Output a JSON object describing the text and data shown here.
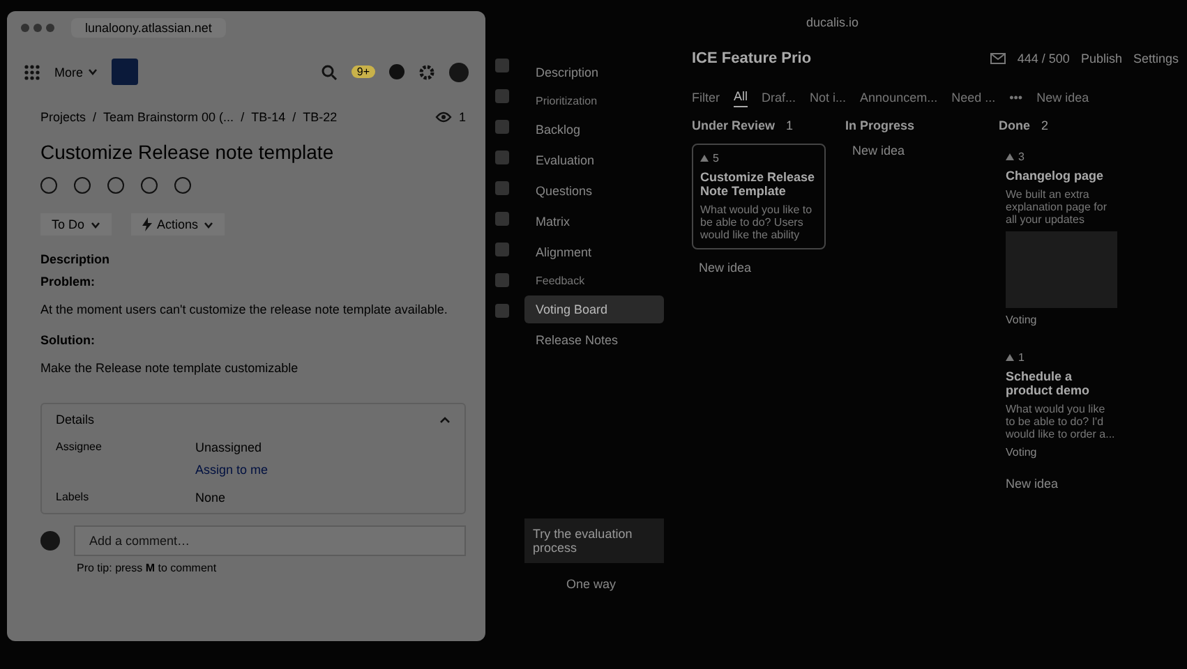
{
  "browser": {
    "url": "lunaloony.atlassian.net"
  },
  "topbar": {
    "more": "More",
    "notification_count": "9+"
  },
  "breadcrumbs": {
    "separator": "/",
    "items": [
      "Projects",
      "Team Brainstorm 00 (...",
      "TB-14",
      "TB-22"
    ]
  },
  "watchers": "1",
  "issue": {
    "title": "Customize Release note template",
    "status": "To Do",
    "actions": "Actions"
  },
  "description": {
    "heading": "Description",
    "problem_label": "Problem:",
    "problem": "At the moment users can't customize the release note template available.",
    "solution_label": "Solution:",
    "solution": "Make the Release note template customizable"
  },
  "details": {
    "heading": "Details",
    "fields": [
      {
        "label": "Assignee",
        "value": "Unassigned",
        "action": "Assign to me"
      },
      {
        "label": "Labels",
        "value": "None"
      }
    ]
  },
  "comment": {
    "placeholder": "Add a comment…",
    "tip_before": "Pro tip: press",
    "tip_key": "M",
    "tip_after": "to comment"
  },
  "right_browser": {
    "url": "ducalis.io"
  },
  "sidebar": {
    "items": [
      {
        "label": "Description",
        "kind": "item",
        "selected": false
      },
      {
        "label": "Prioritization",
        "kind": "section"
      },
      {
        "label": "Backlog",
        "kind": "item",
        "selected": false
      },
      {
        "label": "Evaluation",
        "kind": "item",
        "selected": false
      },
      {
        "label": "Questions",
        "kind": "item",
        "selected": false
      },
      {
        "label": "Matrix",
        "kind": "item",
        "selected": false
      },
      {
        "label": "Alignment",
        "kind": "item",
        "selected": false
      },
      {
        "label": "Feedback",
        "kind": "section"
      },
      {
        "label": "Voting Board",
        "kind": "item",
        "selected": true
      },
      {
        "label": "Release Notes",
        "kind": "item",
        "selected": false
      }
    ],
    "promo": "Try the evaluation process",
    "footer": "One way"
  },
  "board": {
    "title": "ICE Feature Prio",
    "quota": "444 / 500",
    "publish": "Publish",
    "settings": "Settings",
    "filter": "Filter",
    "tabs": [
      {
        "label": "All",
        "selected": true
      },
      {
        "label": "Draf...",
        "selected": false
      },
      {
        "label": "Not i...",
        "selected": false
      },
      {
        "label": "Announcem...",
        "selected": false
      },
      {
        "label": "Need ...",
        "selected": false
      }
    ],
    "more": "•••",
    "new_idea": "New idea",
    "columns": [
      {
        "name": "Under Review",
        "count": "1",
        "cards": [
          {
            "votes": "5",
            "title": "Customize Release Note Template",
            "text": "What would you like to be able to do? Users would like the ability",
            "image": false
          }
        ],
        "add": "New idea"
      },
      {
        "name": "In Progress",
        "add": "New idea"
      },
      {
        "name": "Done",
        "count": "2",
        "cards": [
          {
            "votes": "3",
            "title": "Changelog page",
            "text": "We built an extra explanation page for all your updates",
            "image": true,
            "tag": "Voting"
          },
          {
            "votes": "1",
            "title": "Schedule a product demo",
            "text": "What would you like to be able to do? I'd would like to order a...",
            "image": false,
            "tag": "Voting"
          }
        ],
        "add": "New idea"
      }
    ]
  }
}
